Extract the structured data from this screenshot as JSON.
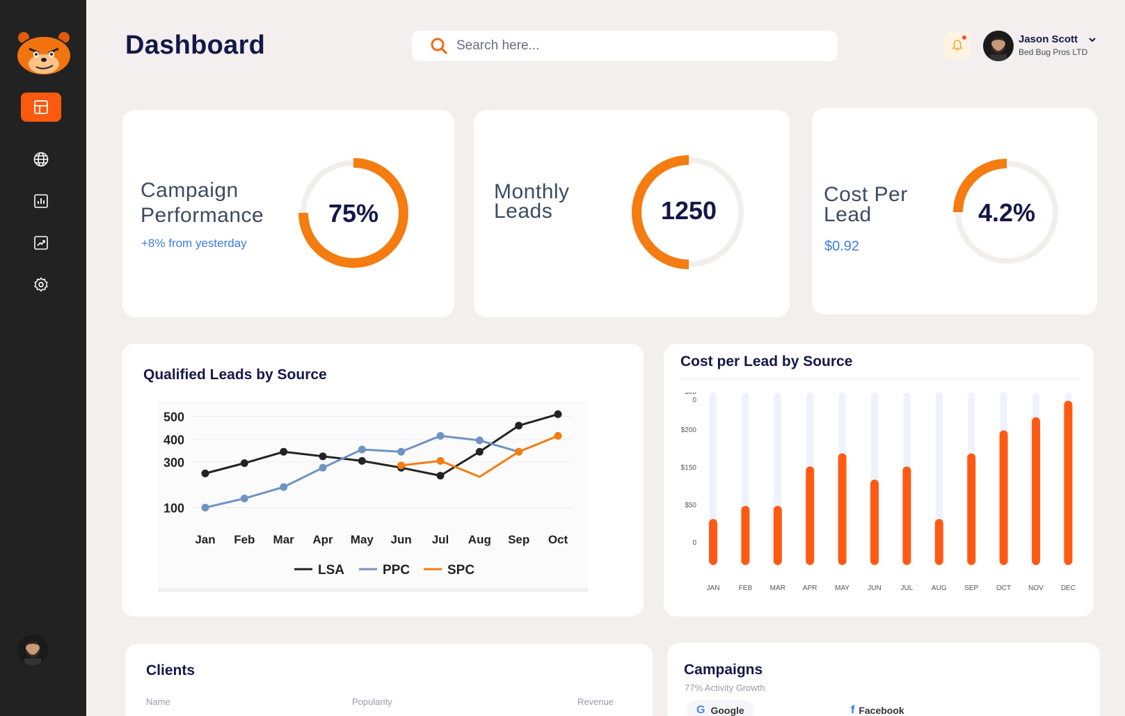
{
  "header": {
    "title": "Dashboard",
    "search_placeholder": "Search here...",
    "user_name": "Jason Scott",
    "user_company": "Bed Bug Pros LTD"
  },
  "sidebar": {
    "items": [
      {
        "icon": "layout-icon",
        "active": true
      },
      {
        "icon": "globe-icon",
        "active": false
      },
      {
        "icon": "bar-chart-icon",
        "active": false
      },
      {
        "icon": "trend-icon",
        "active": false
      },
      {
        "icon": "gear-icon",
        "active": false
      }
    ]
  },
  "kpis": [
    {
      "label_line1": "Campaign",
      "label_line2": "Performance",
      "value": "75%",
      "progress": 0.75,
      "sub": "+8% from yesterday"
    },
    {
      "label_line1": "Monthly",
      "label_line2": "Leads",
      "value": "1250",
      "progress": 0.5,
      "sub": ""
    },
    {
      "label_line1": "Cost Per",
      "label_line2": "Lead",
      "value": "4.2%",
      "progress": 0.25,
      "sub": "$0.92"
    }
  ],
  "qualified_leads": {
    "title": "Qualified Leads by Source"
  },
  "cost_per_lead": {
    "title": "Cost per Lead by Source"
  },
  "clients": {
    "title": "Clients",
    "columns": [
      "Name",
      "Popularity",
      "Revenue"
    ]
  },
  "campaigns": {
    "title": "Campaigns",
    "subtitle": "77% Activity Growth",
    "sources": [
      "Google",
      "Facebook"
    ]
  },
  "colors": {
    "accent": "#fa5a0f",
    "ring_orange": "#f47c11",
    "navy": "#15174a",
    "blue_text": "#3d7de8"
  },
  "chart_data": [
    {
      "type": "line",
      "title": "",
      "categories": [
        "Jan",
        "Feb",
        "Mar",
        "Apr",
        "May",
        "Jun",
        "Jul",
        "Aug",
        "Sep",
        "Oct"
      ],
      "y_ticks": [
        500,
        400,
        300,
        100
      ],
      "ylim": [
        80,
        520
      ],
      "legend": "bottom-center",
      "series": [
        {
          "name": "LSA",
          "color": "#222222",
          "values": [
            250,
            295,
            345,
            325,
            305,
            275,
            240,
            345,
            460,
            510
          ]
        },
        {
          "name": "PPC",
          "color": "#6e93c2",
          "values": [
            100,
            140,
            190,
            275,
            355,
            345,
            415,
            395,
            345,
            null
          ]
        },
        {
          "name": "SPC",
          "color": "#f47c11",
          "values": [
            null,
            null,
            null,
            null,
            null,
            285,
            305,
            235,
            345,
            415
          ]
        }
      ]
    },
    {
      "type": "bar",
      "title": "",
      "categories": [
        "JAN",
        "FEB",
        "MAR",
        "APR",
        "MAY",
        "JUN",
        "JUL",
        "AUG",
        "SEP",
        "OCT",
        "NOV",
        "DEC"
      ],
      "y_ticks": [
        "$55\n0",
        "$200",
        "$150",
        "$50",
        "0"
      ],
      "values": [
        0.28,
        0.36,
        0.36,
        0.6,
        0.68,
        0.52,
        0.6,
        0.28,
        0.68,
        0.82,
        0.9,
        1.0
      ],
      "color": "#ff5a14",
      "track_color": "#eef2fb"
    }
  ]
}
